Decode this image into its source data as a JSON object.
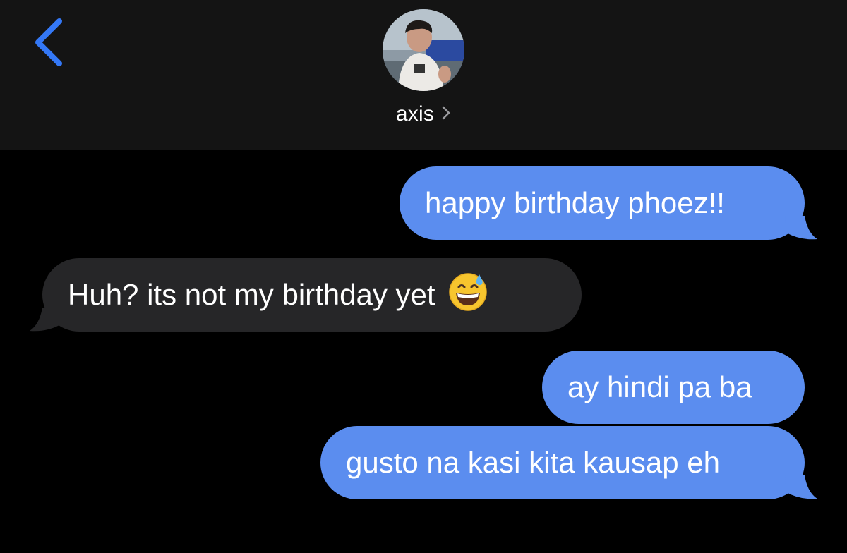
{
  "header": {
    "contact_name": "axis",
    "back_icon": "chevron-left-icon",
    "name_chevron_icon": "chevron-right-icon",
    "accent_color": "#3478f6"
  },
  "messages": [
    {
      "direction": "sent",
      "text": "happy birthday phoez!!"
    },
    {
      "direction": "received",
      "text": "Huh? its not my birthday yet",
      "emoji": "grinning-face-with-sweat-emoji"
    },
    {
      "direction": "sent",
      "text": "ay hindi pa ba"
    },
    {
      "direction": "sent",
      "text": "gusto na kasi kita kausap eh"
    }
  ],
  "colors": {
    "sent_bubble": "#5b8def",
    "received_bubble": "#262628",
    "background": "#000000",
    "header_background": "#141414"
  }
}
